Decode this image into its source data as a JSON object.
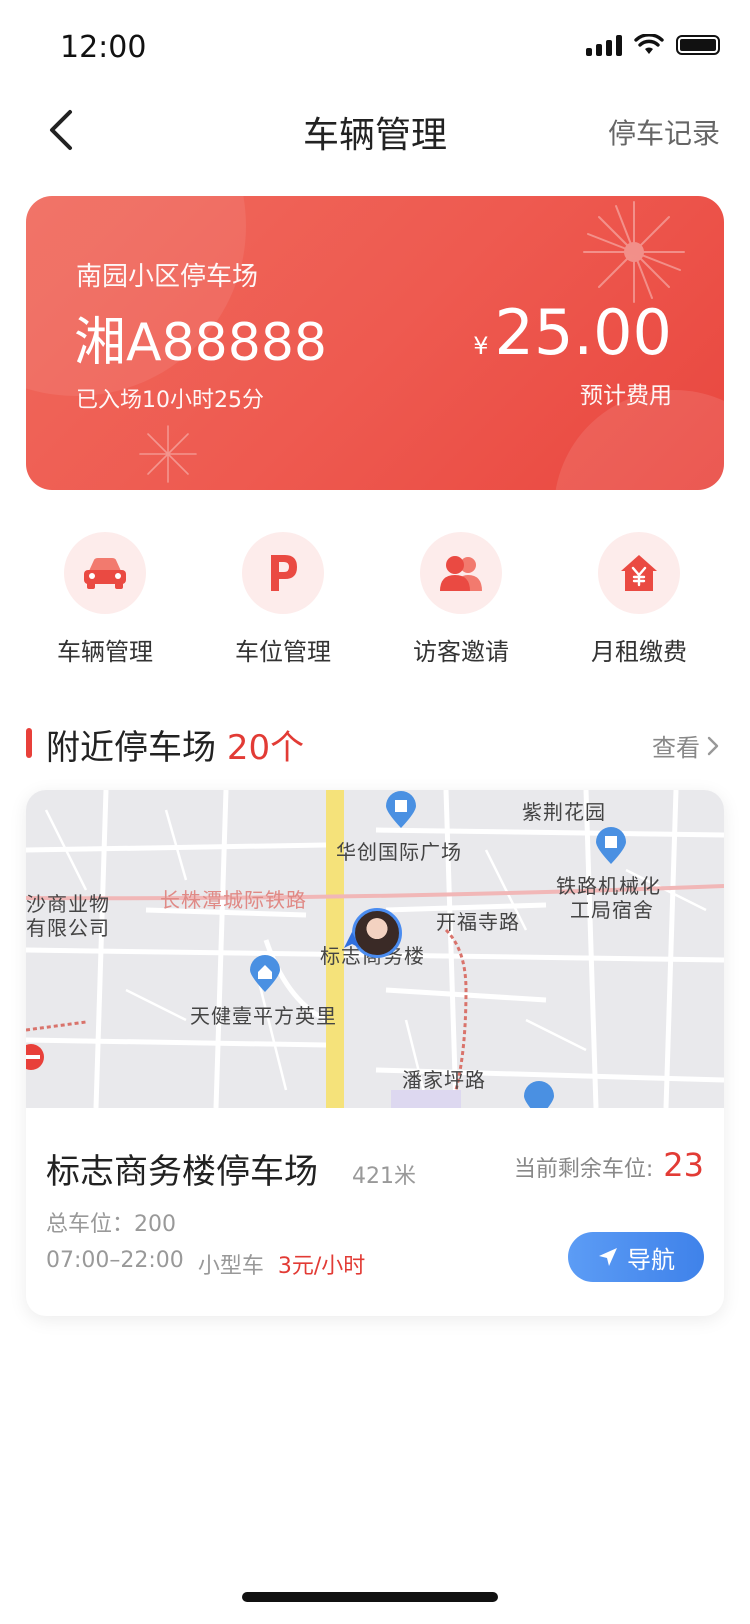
{
  "status": {
    "time": "12:00"
  },
  "nav": {
    "title": "车辆管理",
    "right_label": "停车记录"
  },
  "parking_card": {
    "lot_name": "南园小区停车场",
    "plate": "湘A88888",
    "duration": "已入场10小时25分",
    "currency": "¥",
    "fee": "25.00",
    "fee_label": "预计费用"
  },
  "shortcuts": [
    {
      "label": "车辆管理",
      "icon": "car-icon"
    },
    {
      "label": "车位管理",
      "icon": "parking-p-icon"
    },
    {
      "label": "访客邀请",
      "icon": "users-icon"
    },
    {
      "label": "月租缴费",
      "icon": "house-yen-icon"
    }
  ],
  "nearby": {
    "title": "附近停车场",
    "count": "20个",
    "more_label": "查看"
  },
  "map": {
    "labels": {
      "a": "紫荆花园",
      "b": "华创国际广场",
      "c": "长株潭城际铁路",
      "d": "铁路机械化",
      "e": "工局宿舍",
      "f": "开福寺路",
      "g": "沙商业物",
      "h": "有限公司",
      "i": "标志商务楼",
      "j": "天健壹平方英里",
      "k": "潘家坪路"
    }
  },
  "lot": {
    "name": "标志商务楼停车场",
    "distance": "421米",
    "remaining_label": "当前剩余车位:",
    "remaining": "23",
    "total": "总车位：200",
    "hours": "07:00–22:00",
    "vehicle_type": "小型车",
    "price": "3元/小时",
    "nav_label": "导航"
  },
  "colors": {
    "accent": "#e8403a",
    "nav_button": "#4a8cf0"
  }
}
